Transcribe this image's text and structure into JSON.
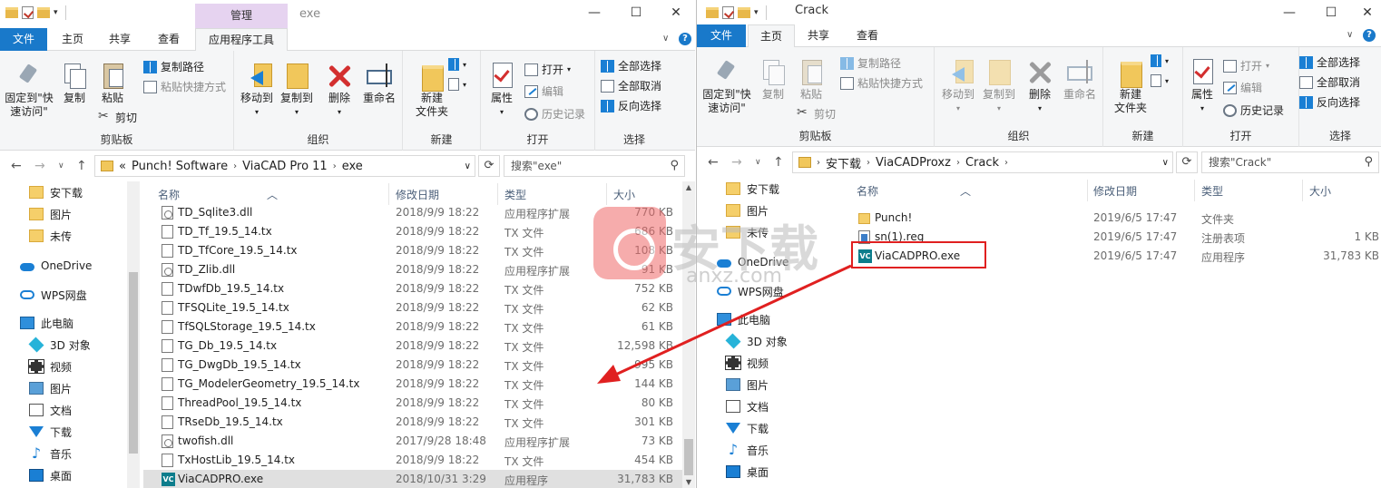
{
  "left": {
    "context_tab": "管理",
    "title": "exe",
    "tabs": {
      "file": "文件",
      "home": "主页",
      "share": "共享",
      "view": "查看",
      "app_tools": "应用程序工具"
    },
    "ribbon": {
      "pin": "固定到\"快\n速访问\"",
      "copy": "复制",
      "paste": "粘贴",
      "copy_path": "复制路径",
      "paste_shortcut": "粘贴快捷方式",
      "cut": "剪切",
      "group_clipboard": "剪贴板",
      "move_to": "移动到",
      "copy_to": "复制到",
      "delete": "删除",
      "rename": "重命名",
      "group_organize": "组织",
      "new_folder": "新建\n文件夹",
      "group_new": "新建",
      "properties": "属性",
      "open": "打开",
      "edit": "编辑",
      "history": "历史记录",
      "group_open": "打开",
      "select_all": "全部选择",
      "select_none": "全部取消",
      "invert": "反向选择",
      "group_select": "选择"
    },
    "breadcrumb": [
      "«",
      "Punch! Software",
      "ViaCAD Pro 11",
      "exe"
    ],
    "search_placeholder": "搜索\"exe\"",
    "nav": [
      "安下载",
      "图片",
      "未传",
      "OneDrive",
      "WPS网盘",
      "此电脑",
      "3D 对象",
      "视频",
      "图片",
      "文档",
      "下载",
      "音乐",
      "桌面"
    ],
    "columns": {
      "name": "名称",
      "date": "修改日期",
      "type": "类型",
      "size": "大小"
    },
    "files": [
      {
        "name": "TD_Sqlite3.dll",
        "date": "2018/9/9 18:22",
        "type": "应用程序扩展",
        "size": "770 KB",
        "icon": "dll"
      },
      {
        "name": "TD_Tf_19.5_14.tx",
        "date": "2018/9/9 18:22",
        "type": "TX 文件",
        "size": "686 KB",
        "icon": "txt"
      },
      {
        "name": "TD_TfCore_19.5_14.tx",
        "date": "2018/9/9 18:22",
        "type": "TX 文件",
        "size": "108 KB",
        "icon": "txt"
      },
      {
        "name": "TD_Zlib.dll",
        "date": "2018/9/9 18:22",
        "type": "应用程序扩展",
        "size": "91 KB",
        "icon": "dll"
      },
      {
        "name": "TDwfDb_19.5_14.tx",
        "date": "2018/9/9 18:22",
        "type": "TX 文件",
        "size": "752 KB",
        "icon": "txt"
      },
      {
        "name": "TFSQLite_19.5_14.tx",
        "date": "2018/9/9 18:22",
        "type": "TX 文件",
        "size": "62 KB",
        "icon": "txt"
      },
      {
        "name": "TfSQLStorage_19.5_14.tx",
        "date": "2018/9/9 18:22",
        "type": "TX 文件",
        "size": "61 KB",
        "icon": "txt"
      },
      {
        "name": "TG_Db_19.5_14.tx",
        "date": "2018/9/9 18:22",
        "type": "TX 文件",
        "size": "12,598 KB",
        "icon": "txt"
      },
      {
        "name": "TG_DwgDb_19.5_14.tx",
        "date": "2018/9/9 18:22",
        "type": "TX 文件",
        "size": "995 KB",
        "icon": "txt"
      },
      {
        "name": "TG_ModelerGeometry_19.5_14.tx",
        "date": "2018/9/9 18:22",
        "type": "TX 文件",
        "size": "144 KB",
        "icon": "txt"
      },
      {
        "name": "ThreadPool_19.5_14.tx",
        "date": "2018/9/9 18:22",
        "type": "TX 文件",
        "size": "80 KB",
        "icon": "txt"
      },
      {
        "name": "TRseDb_19.5_14.tx",
        "date": "2018/9/9 18:22",
        "type": "TX 文件",
        "size": "301 KB",
        "icon": "txt"
      },
      {
        "name": "twofish.dll",
        "date": "2017/9/28 18:48",
        "type": "应用程序扩展",
        "size": "73 KB",
        "icon": "dll"
      },
      {
        "name": "TxHostLib_19.5_14.tx",
        "date": "2018/9/9 18:22",
        "type": "TX 文件",
        "size": "454 KB",
        "icon": "txt"
      },
      {
        "name": "ViaCADPRO.exe",
        "date": "2018/10/31 3:29",
        "type": "应用程序",
        "size": "31,783 KB",
        "icon": "exe"
      }
    ]
  },
  "right": {
    "title": "Crack",
    "tabs": {
      "file": "文件",
      "home": "主页",
      "share": "共享",
      "view": "查看"
    },
    "ribbon": {
      "pin": "固定到\"快\n速访问\"",
      "copy": "复制",
      "paste": "粘贴",
      "copy_path": "复制路径",
      "paste_shortcut": "粘贴快捷方式",
      "cut": "剪切",
      "group_clipboard": "剪贴板",
      "move_to": "移动到",
      "copy_to": "复制到",
      "delete": "删除",
      "rename": "重命名",
      "group_organize": "组织",
      "new_folder": "新建\n文件夹",
      "group_new": "新建",
      "properties": "属性",
      "open": "打开",
      "edit": "编辑",
      "history": "历史记录",
      "group_open": "打开",
      "select_all": "全部选择",
      "select_none": "全部取消",
      "invert": "反向选择",
      "group_select": "选择"
    },
    "breadcrumb": [
      "安下载",
      "ViaCADProxz",
      "Crack"
    ],
    "search_placeholder": "搜索\"Crack\"",
    "nav": [
      "安下载",
      "图片",
      "未传",
      "OneDrive",
      "WPS网盘",
      "此电脑",
      "3D 对象",
      "视频",
      "图片",
      "文档",
      "下载",
      "音乐",
      "桌面"
    ],
    "columns": {
      "name": "名称",
      "date": "修改日期",
      "type": "类型",
      "size": "大小"
    },
    "files": [
      {
        "name": "Punch!",
        "date": "2019/6/5 17:47",
        "type": "文件夹",
        "size": "",
        "icon": "fold"
      },
      {
        "name": "sn(1).reg",
        "date": "2019/6/5 17:47",
        "type": "注册表项",
        "size": "1 KB",
        "icon": "reg"
      },
      {
        "name": "ViaCADPRO.exe",
        "date": "2019/6/5 17:47",
        "type": "应用程序",
        "size": "31,783 KB",
        "icon": "exe"
      }
    ]
  },
  "watermark": {
    "text": "安下载",
    "sub": "anxz.com"
  },
  "colors": {
    "accent": "#1979ca",
    "annotation": "#e02020",
    "context_tab": "#e6d3f0"
  }
}
